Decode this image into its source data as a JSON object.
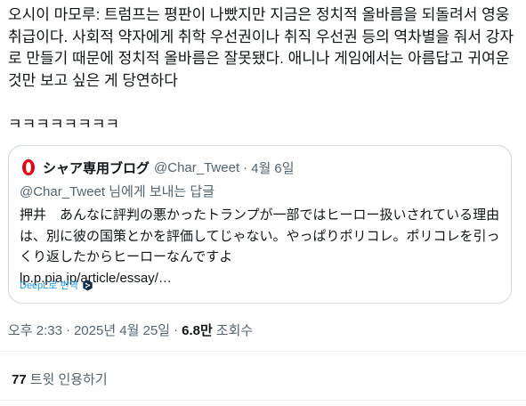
{
  "tweet": {
    "text": "오시이 마모루: 트럼프는 평판이 나빴지만 지금은 정치적 올바름을 되돌려서 영웅 취급이다. 사회적 약자에게 취학 우선권이나 취직 우선권 등의 역차별을 줘서 강자로 만들기 때문에 정치적 올바름은 잘못됐다. 애니나 게임에서는 아름답고 귀여운 것만 보고 싶은 게 당연하다\n\nㅋㅋㅋㅋㅋㅋㅋㅋ",
    "time": "오후 2:33",
    "date": "2025년 4월 25일",
    "separator": "·",
    "views_count": "6.8만",
    "views_label": "조회수"
  },
  "quote": {
    "display_name": "シャア専用ブログ",
    "handle": "@Char_Tweet",
    "separator": "·",
    "date": "4월 6일",
    "reply_to": "@Char_Tweet 님에게 보내는 답글",
    "text": "押井　あんなに評判の悪かったトランプが一部ではヒーロー扱いされている理由は、別に彼の国策とかを評価してじゃない。やっぱりポリコレ。ポリコレを引っくり返したからヒーローなんですよ\nlp.p.pia.jp/article/essay/…",
    "translate_label": "DeepL로 번역",
    "avatar_color": "#e60012"
  },
  "quotes": {
    "count": "77",
    "label": "트윗 인용하기"
  },
  "colors": {
    "text": "#0f1419",
    "secondary": "#536471",
    "link": "#1d9bf0",
    "border": "#cfd9de"
  }
}
